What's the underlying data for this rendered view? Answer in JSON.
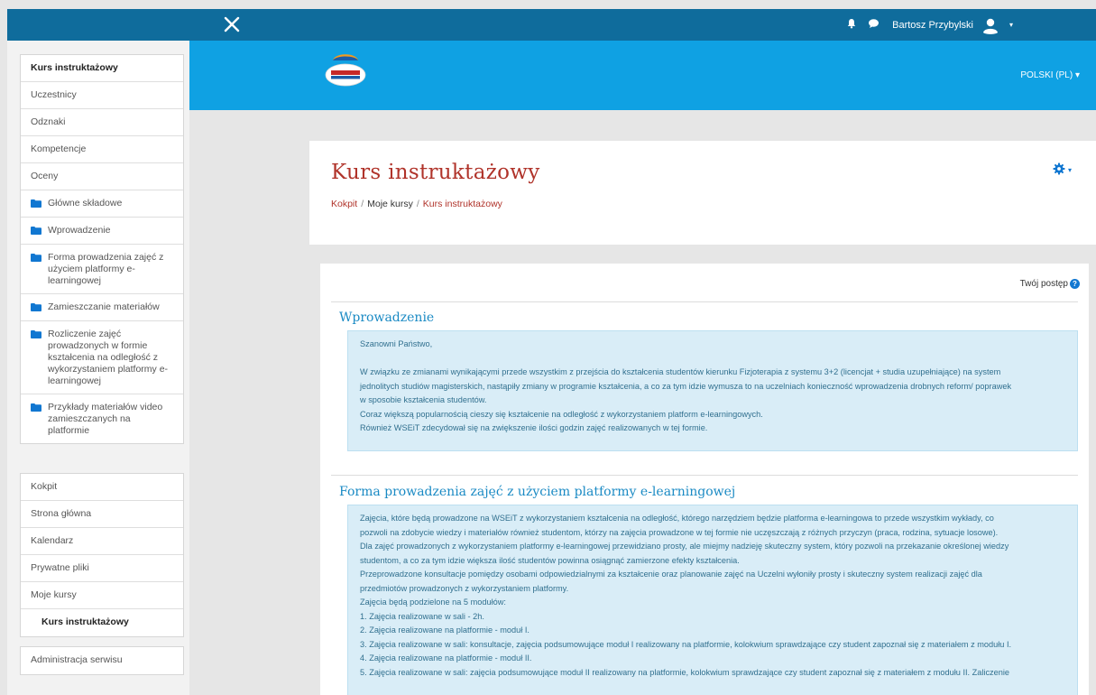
{
  "topbar": {
    "user_name": "Bartosz Przybylski"
  },
  "banner": {
    "language": "POLSKI (PL) ▾"
  },
  "sidebar": {
    "course_nav": [
      {
        "label": "Kurs instruktażowy",
        "bold": true
      },
      {
        "label": "Uczestnicy"
      },
      {
        "label": "Odznaki"
      },
      {
        "label": "Kompetencje"
      },
      {
        "label": "Oceny"
      },
      {
        "label": "Główne składowe",
        "folder": true
      },
      {
        "label": "Wprowadzenie",
        "folder": true
      },
      {
        "label": "Forma prowadzenia zajęć z użyciem platformy e-learningowej",
        "folder": true
      },
      {
        "label": "Zamieszczanie materiałów",
        "folder": true
      },
      {
        "label": "Rozliczenie zajęć prowadzonych w formie kształcenia na odległość z wykorzystaniem platformy e-learningowej",
        "folder": true
      },
      {
        "label": "Przykłady materiałów video zamieszczanych na platformie",
        "folder": true
      }
    ],
    "site_nav": [
      {
        "label": "Kokpit"
      },
      {
        "label": "Strona główna"
      },
      {
        "label": "Kalendarz"
      },
      {
        "label": "Prywatne pliki"
      },
      {
        "label": "Moje kursy"
      },
      {
        "label": "Kurs instruktażowy",
        "bold": true,
        "indent": true
      }
    ],
    "admin_nav": [
      {
        "label": "Administracja serwisu"
      }
    ]
  },
  "header": {
    "title": "Kurs instruktażowy",
    "breadcrumb": {
      "home": "Kokpit",
      "sep": "/",
      "my_courses": "Moje kursy",
      "current": "Kurs instruktażowy"
    }
  },
  "content": {
    "progress_label": "Twój postęp",
    "help_glyph": "?",
    "section1": {
      "title": "Wprowadzenie",
      "lines": [
        "Szanowni Państwo,",
        "",
        "W związku ze zmianami wynikającymi przede wszystkim z przejścia do kształcenia studentów kierunku Fizjoterapia z systemu 3+2 (licencjat + studia uzupełniające) na system",
        "jednolitych studiów magisterskich, nastąpiły zmiany w programie kształcenia, a co za tym idzie wymusza to na uczelniach konieczność wprowadzenia drobnych reform/ poprawek",
        "w sposobie kształcenia studentów.",
        "Coraz większą popularnością cieszy się kształcenie na odległość z wykorzystaniem platform e-learningowych.",
        "Również WSEiT zdecydował się na zwiększenie ilości godzin zajęć realizowanych w tej formie."
      ]
    },
    "section2": {
      "title": "Forma prowadzenia zajęć z użyciem platformy e-learningowej",
      "lines": [
        "Zajęcia, które będą prowadzone na WSEiT z wykorzystaniem kształcenia na odległość, którego narzędziem będzie platforma e-learningowa to przede wszystkim wykłady, co",
        "pozwoli na zdobycie wiedzy i materiałów również studentom, którzy na zajęcia prowadzone w tej formie nie uczęszczają z różnych przyczyn (praca, rodzina, sytuacje losowe).",
        "Dla zajęć prowadzonych z wykorzystaniem platformy e-learningowej przewidziano prosty, ale miejmy nadzieję skuteczny system, który pozwoli na przekazanie określonej wiedzy",
        "studentom, a co za tym idzie większa ilość studentów powinna osiągnąć zamierzone efekty kształcenia.",
        "Przeprowadzone konsultacje pomiędzy osobami odpowiedzialnymi za kształcenie oraz planowanie zajęć na Uczelni wyłoniły prosty i skuteczny system realizacji zajęć dla",
        "przedmiotów prowadzonych z wykorzystaniem platformy.",
        "Zajęcia będą podzielone na 5 modułów:",
        "1. Zajęcia realizowane w sali - 2h.",
        "2. Zajęcia realizowane na platformie - moduł I.",
        "3. Zajęcia realizowane w sali: konsultacje, zajęcia podsumowujące moduł I realizowany na platformie, kolokwium sprawdzające czy student zapoznał się z materiałem z modułu I.",
        "4. Zajęcia realizowane na platformie - moduł II.",
        "5. Zajęcia realizowane w sali: zajęcia podsumowujące moduł II realizowany na platformie, kolokwium sprawdzające czy student zapoznał się z materiałem z modułu II. Zaliczenie"
      ]
    }
  },
  "colors": {
    "navbar": "#0f6c9c",
    "banner": "#0fa1e3",
    "title_red": "#b0332a",
    "section_blue": "#1a8ac4",
    "info_bg": "#d9edf7",
    "info_text": "#31708f"
  }
}
